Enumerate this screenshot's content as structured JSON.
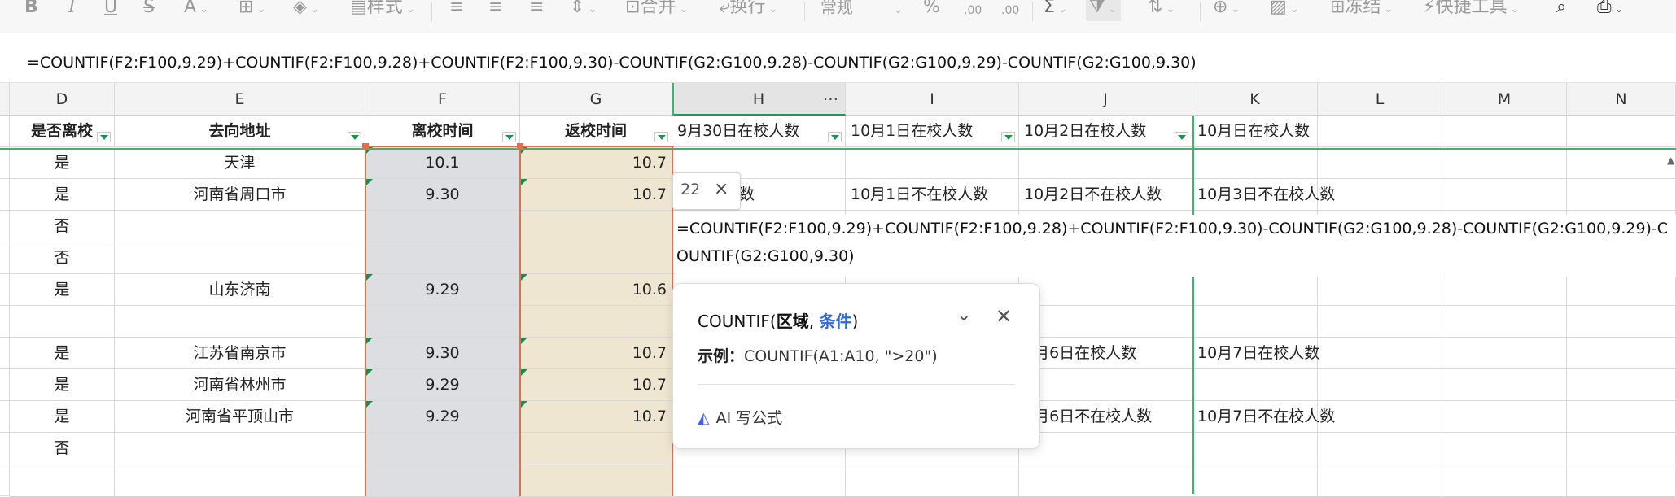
{
  "toolbar": {
    "style_label": "样式",
    "merge_label": "合并",
    "wrap_label": "换行",
    "number_format": "常规",
    "freeze_label": "冻结",
    "quick_tools_label": "快捷工具"
  },
  "formula_bar": {
    "formula": "=COUNTIF(F2:F100,9.29)+COUNTIF(F2:F100,9.28)+COUNTIF(F2:F100,9.30)-COUNTIF(G2:G100,9.28)-COUNTIF(G2:G100,9.29)-COUNTIF(G2:G100,9.30)"
  },
  "columns": [
    "D",
    "E",
    "F",
    "G",
    "H",
    "I",
    "J",
    "K",
    "L",
    "M",
    "N"
  ],
  "header_more": "···",
  "headers": {
    "D": "是否离校",
    "E": "去向地址",
    "F": "离校时间",
    "G": "返校时间",
    "H": "9月30日在校人数",
    "I": "10月1日在校人数",
    "J": "10月2日在校人数",
    "K": "10月日在校人数"
  },
  "rows": [
    {
      "D": "是",
      "E": "天津",
      "F": "10.1",
      "G": "10.7"
    },
    {
      "D": "是",
      "E": "河南省周口市",
      "F": "9.30",
      "G": "10.7",
      "H": "不在校人数",
      "I": "10月1日不在校人数",
      "J": "10月2日不在校人数",
      "K": "10月3日不在校人数"
    },
    {
      "D": "否"
    },
    {
      "D": "否"
    },
    {
      "D": "是",
      "E": "山东济南",
      "F": "9.29",
      "G": "10.6"
    },
    {},
    {
      "D": "是",
      "E": "江苏省南京市",
      "F": "9.30",
      "G": "10.7",
      "J": "0月6日在校人数",
      "K": "10月7日在校人数"
    },
    {
      "D": "是",
      "E": "河南省林州市",
      "F": "9.29",
      "G": "10.7"
    },
    {
      "D": "是",
      "E": "河南省平顶山市",
      "F": "9.29",
      "G": "10.7",
      "J": "0月6日不在校人数",
      "K": "10月7日不在校人数"
    },
    {
      "D": "否"
    }
  ],
  "count_tag": {
    "value": "22",
    "close": "×"
  },
  "editor": {
    "formula": "=COUNTIF(F2:F100,9.29)+COUNTIF(F2:F100,9.28)+COUNTIF(F2:F100,9.30)-COUNTIF(G2:G100,9.28)-COUNTIF(G2:G100,9.29)-COUNTIF(G2:G100,9.30)"
  },
  "tooltip": {
    "func": "COUNTIF(",
    "arg1": "区域",
    "sep": ", ",
    "arg2": "条件",
    "close_paren": ")",
    "example_label": "示例：",
    "example": "COUNTIF(A1:A10, \">20\")",
    "ai_label": "AI 写公式"
  },
  "colors": {
    "accent_green": "#1f8a4c",
    "selection_orange": "#e0704d",
    "link_blue": "#2f6bd8"
  }
}
